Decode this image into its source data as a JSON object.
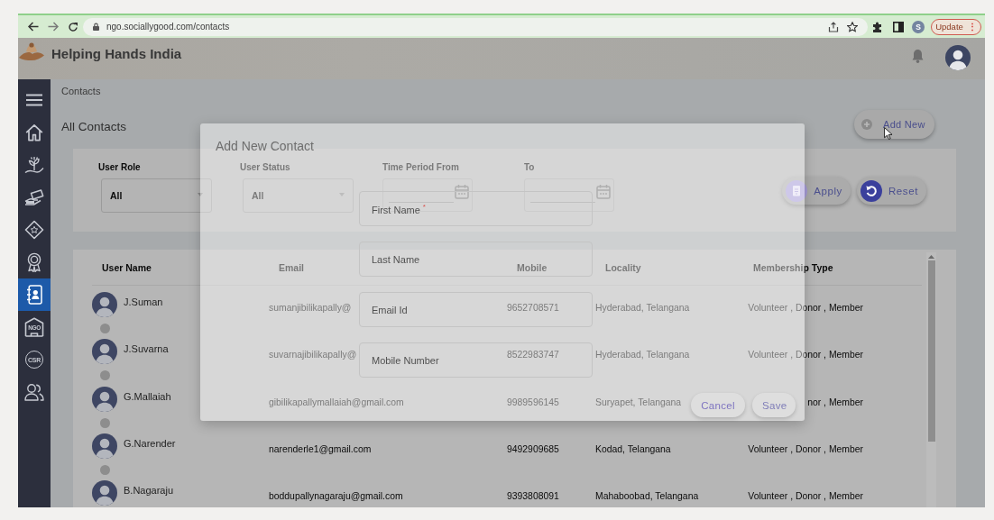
{
  "browser": {
    "url": "ngo.sociallygood.com/contacts",
    "profile_initial": "S",
    "update_label": "Update",
    "update_menu": "⋮"
  },
  "header": {
    "title": "Helping Hands India"
  },
  "sidebar": {
    "items": [
      {
        "kind": "menu",
        "selected": false
      },
      {
        "kind": "home",
        "selected": false
      },
      {
        "kind": "sprout",
        "selected": false
      },
      {
        "kind": "cash",
        "selected": false
      },
      {
        "kind": "star",
        "selected": false
      },
      {
        "kind": "award",
        "selected": false
      },
      {
        "kind": "contacts",
        "selected": true
      },
      {
        "kind": "ngo",
        "label": "NGO",
        "selected": false
      },
      {
        "kind": "csr",
        "label": "CSR",
        "selected": false
      },
      {
        "kind": "people",
        "selected": false
      }
    ]
  },
  "page": {
    "breadcrumb": "Contacts",
    "title": "All Contacts",
    "add_button": "Add New"
  },
  "filters": {
    "fields": [
      {
        "kind": "select",
        "label": "User Role",
        "value": "All"
      },
      {
        "kind": "select",
        "label": "User Status",
        "value": "All"
      },
      {
        "kind": "date",
        "label": "Time Period From"
      },
      {
        "kind": "date",
        "label": "To"
      }
    ],
    "buttons": [
      {
        "kind": "apply",
        "label": "Apply"
      },
      {
        "kind": "reset",
        "label": "Reset"
      }
    ]
  },
  "table": {
    "columns": [
      "User Name",
      "Email",
      "Mobile",
      "Locality",
      "Membership Type"
    ],
    "rows": [
      {
        "name": "J.Suman",
        "email": "sumanjibilikapally@",
        "mobile": "9652708571",
        "locality": "Hyderabad, Telangana",
        "membership": "Volunteer , Donor , Member"
      },
      {
        "name": "J.Suvarna",
        "email": "suvarnajibilikapally@",
        "mobile": "8522983747",
        "locality": "Hyderabad, Telangana",
        "membership": "Volunteer , Donor , Member"
      },
      {
        "name": "G.Mallaiah",
        "email": "gibilikapallymallaiah@gmail.com",
        "mobile": "9989596145",
        "locality": "Suryapet, Telangana",
        "membership": "nor , Member"
      },
      {
        "name": "G.Narender",
        "email": "narenderle1@gmail.com",
        "mobile": "9492909685",
        "locality": "Kodad, Telangana",
        "membership": "Volunteer , Donor , Member"
      },
      {
        "name": "B.Nagaraju",
        "email": "boddupallynagaraju@gmail.com",
        "mobile": "9393808091",
        "locality": "Mahaboobad, Telangana",
        "membership": "Volunteer , Donor , Member"
      }
    ]
  },
  "modal": {
    "title": "Add New Contact",
    "fields": [
      {
        "label": "First Name $^{*}$"
      },
      {
        "label": "Last Name"
      },
      {
        "label": "Email Id"
      },
      {
        "label": "Mobile Number"
      }
    ],
    "buttons": [
      {
        "kind": "cancel",
        "label": "Cancel"
      },
      {
        "kind": "save",
        "label": "Save"
      }
    ]
  }
}
